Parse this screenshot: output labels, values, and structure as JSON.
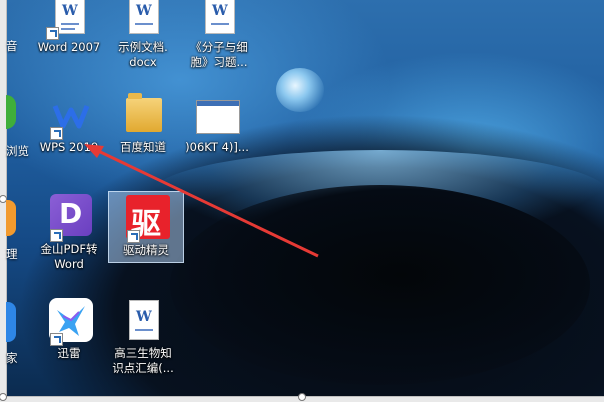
{
  "desktop_icons": {
    "word2007": {
      "label": "Word 2007",
      "icon": "word-document-icon"
    },
    "example_docx": {
      "line1": "示例文档.",
      "line2": "docx",
      "icon": "word-document-icon"
    },
    "cell_quiz": {
      "line1": "《分子与细",
      "line2": "胞》习题...",
      "icon": "word-document-icon"
    },
    "wps2019": {
      "label": "WPS 2019",
      "icon": "wps-icon"
    },
    "baidu": {
      "label": "百度知道",
      "icon": "folder-icon"
    },
    "screenshot_file": {
      "label": ")06KT 4)]...",
      "icon": "screenshot-thumbnail-icon"
    },
    "pdf_to_word": {
      "line1": "金山PDF转",
      "line2": "Word",
      "icon": "pdf-converter-icon"
    },
    "driver_genius": {
      "label": "驱动精灵",
      "icon": "driver-genius-icon",
      "glyph": "驱"
    },
    "xunlei": {
      "label": "迅雷",
      "icon": "xunlei-icon"
    },
    "biology_notes": {
      "line1": "高三生物知",
      "line2": "识点汇编(...",
      "icon": "word-document-icon"
    }
  },
  "partial_left_labels": [
    "音",
    "浏览",
    "理",
    "家"
  ],
  "colors": {
    "arrow": "#e63a35",
    "selection": "#aac8eb"
  }
}
